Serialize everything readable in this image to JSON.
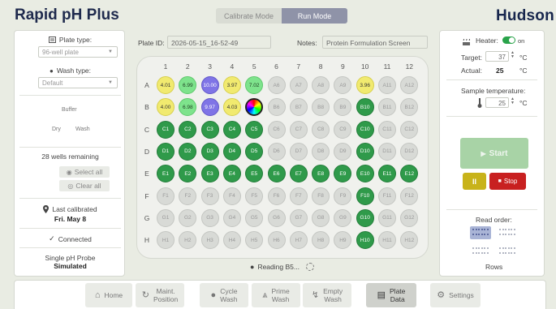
{
  "app": {
    "title": "Rapid pH Plus",
    "brand": "Hudson"
  },
  "modes": {
    "calibrate": "Calibrate Mode",
    "run": "Run Mode"
  },
  "left": {
    "plate_type_label": "Plate type:",
    "plate_type_value": "96-well plate",
    "wash_type_label": "Wash type:",
    "wash_type_value": "Default",
    "buffer_label": "Buffer",
    "dry_label": "Dry",
    "wash_label": "Wash",
    "wells_remaining": "28 wells remaining",
    "select_all": "Select all",
    "clear_all": "Clear all",
    "last_calibrated_label": "Last calibrated",
    "last_calibrated_date": "Fri. May 8",
    "connected": "Connected",
    "probe": "Single pH Probe",
    "probe_mode": "Simulated"
  },
  "plate": {
    "id_label": "Plate ID:",
    "id_value": "2026-05-15_16-52-49",
    "notes_label": "Notes:",
    "notes_placeholder": "Protein Formulation Screen",
    "reading": "Reading B5...",
    "columns": [
      "1",
      "2",
      "3",
      "4",
      "5",
      "6",
      "7",
      "8",
      "9",
      "10",
      "11",
      "12"
    ],
    "rows": [
      {
        "label": "A",
        "wells": [
          {
            "t": "4.01",
            "s": "y"
          },
          {
            "t": "6.99",
            "s": "g"
          },
          {
            "t": "10.00",
            "s": "p"
          },
          {
            "t": "3.97",
            "s": "y"
          },
          {
            "t": "7.02",
            "s": "g"
          },
          {
            "t": "A6",
            "s": "e"
          },
          {
            "t": "A7",
            "s": "e"
          },
          {
            "t": "A8",
            "s": "e"
          },
          {
            "t": "A9",
            "s": "e"
          },
          {
            "t": "3.96",
            "s": "y"
          },
          {
            "t": "A11",
            "s": "e"
          },
          {
            "t": "A12",
            "s": "e"
          }
        ]
      },
      {
        "label": "B",
        "wells": [
          {
            "t": "4.00",
            "s": "y"
          },
          {
            "t": "6.98",
            "s": "g"
          },
          {
            "t": "9.97",
            "s": "p"
          },
          {
            "t": "4.03",
            "s": "y"
          },
          {
            "t": "",
            "s": "rb"
          },
          {
            "t": "B6",
            "s": "e"
          },
          {
            "t": "B7",
            "s": "e"
          },
          {
            "t": "B8",
            "s": "e"
          },
          {
            "t": "B9",
            "s": "e"
          },
          {
            "t": "B10",
            "s": "d"
          },
          {
            "t": "B11",
            "s": "e"
          },
          {
            "t": "B12",
            "s": "e"
          }
        ]
      },
      {
        "label": "C",
        "wells": [
          {
            "t": "C1",
            "s": "d"
          },
          {
            "t": "C2",
            "s": "d"
          },
          {
            "t": "C3",
            "s": "d"
          },
          {
            "t": "C4",
            "s": "d"
          },
          {
            "t": "C5",
            "s": "d"
          },
          {
            "t": "C6",
            "s": "e"
          },
          {
            "t": "C7",
            "s": "e"
          },
          {
            "t": "C8",
            "s": "e"
          },
          {
            "t": "C9",
            "s": "e"
          },
          {
            "t": "C10",
            "s": "d"
          },
          {
            "t": "C11",
            "s": "e"
          },
          {
            "t": "C12",
            "s": "e"
          }
        ]
      },
      {
        "label": "D",
        "wells": [
          {
            "t": "D1",
            "s": "d"
          },
          {
            "t": "D2",
            "s": "d"
          },
          {
            "t": "D3",
            "s": "d"
          },
          {
            "t": "D4",
            "s": "d"
          },
          {
            "t": "D5",
            "s": "d"
          },
          {
            "t": "D6",
            "s": "e"
          },
          {
            "t": "D7",
            "s": "e"
          },
          {
            "t": "D8",
            "s": "e"
          },
          {
            "t": "D9",
            "s": "e"
          },
          {
            "t": "D10",
            "s": "d"
          },
          {
            "t": "D11",
            "s": "e"
          },
          {
            "t": "D12",
            "s": "e"
          }
        ]
      },
      {
        "label": "E",
        "wells": [
          {
            "t": "E1",
            "s": "d"
          },
          {
            "t": "E2",
            "s": "d"
          },
          {
            "t": "E3",
            "s": "d"
          },
          {
            "t": "E4",
            "s": "d"
          },
          {
            "t": "E5",
            "s": "d"
          },
          {
            "t": "E6",
            "s": "d"
          },
          {
            "t": "E7",
            "s": "d"
          },
          {
            "t": "E8",
            "s": "d"
          },
          {
            "t": "E9",
            "s": "d"
          },
          {
            "t": "E10",
            "s": "d"
          },
          {
            "t": "E11",
            "s": "d"
          },
          {
            "t": "E12",
            "s": "d"
          }
        ]
      },
      {
        "label": "F",
        "wells": [
          {
            "t": "F1",
            "s": "e"
          },
          {
            "t": "F2",
            "s": "e"
          },
          {
            "t": "F3",
            "s": "e"
          },
          {
            "t": "F4",
            "s": "e"
          },
          {
            "t": "F5",
            "s": "e"
          },
          {
            "t": "F6",
            "s": "e"
          },
          {
            "t": "F7",
            "s": "e"
          },
          {
            "t": "F8",
            "s": "e"
          },
          {
            "t": "F9",
            "s": "e"
          },
          {
            "t": "F10",
            "s": "d"
          },
          {
            "t": "F11",
            "s": "e"
          },
          {
            "t": "F12",
            "s": "e"
          }
        ]
      },
      {
        "label": "G",
        "wells": [
          {
            "t": "G1",
            "s": "e"
          },
          {
            "t": "G2",
            "s": "e"
          },
          {
            "t": "G3",
            "s": "e"
          },
          {
            "t": "G4",
            "s": "e"
          },
          {
            "t": "G5",
            "s": "e"
          },
          {
            "t": "G6",
            "s": "e"
          },
          {
            "t": "G7",
            "s": "e"
          },
          {
            "t": "G8",
            "s": "e"
          },
          {
            "t": "G9",
            "s": "e"
          },
          {
            "t": "G10",
            "s": "d"
          },
          {
            "t": "G11",
            "s": "e"
          },
          {
            "t": "G12",
            "s": "e"
          }
        ]
      },
      {
        "label": "H",
        "wells": [
          {
            "t": "H1",
            "s": "e"
          },
          {
            "t": "H2",
            "s": "e"
          },
          {
            "t": "H3",
            "s": "e"
          },
          {
            "t": "H4",
            "s": "e"
          },
          {
            "t": "H5",
            "s": "e"
          },
          {
            "t": "H6",
            "s": "e"
          },
          {
            "t": "H7",
            "s": "e"
          },
          {
            "t": "H8",
            "s": "e"
          },
          {
            "t": "H9",
            "s": "e"
          },
          {
            "t": "H10",
            "s": "d"
          },
          {
            "t": "H11",
            "s": "e"
          },
          {
            "t": "H12",
            "s": "e"
          }
        ]
      }
    ]
  },
  "right": {
    "heater_label": "Heater:",
    "heater_state": "on",
    "target_label": "Target:",
    "target_value": "37",
    "unit": "°C",
    "actual_label": "Actual:",
    "actual_value": "25",
    "sample_temp_label": "Sample temperature:",
    "sample_temp_value": "25",
    "start": "Start",
    "pause": "II",
    "stop": "Stop",
    "read_order_label": "Read order:",
    "read_order_value": "Rows"
  },
  "nav": {
    "home": "Home",
    "maint_1": "Maint.",
    "maint_2": "Position",
    "cycle_1": "Cycle",
    "cycle_2": "Wash",
    "prime_1": "Prime",
    "prime_2": "Wash",
    "empty_1": "Empty",
    "empty_2": "Wash",
    "plate_1": "Plate",
    "plate_2": "Data",
    "settings": "Settings"
  },
  "colors": {
    "accent": "#1f2a4d",
    "success": "#29a34a",
    "stop": "#c82020",
    "pause": "#c8b31a"
  }
}
